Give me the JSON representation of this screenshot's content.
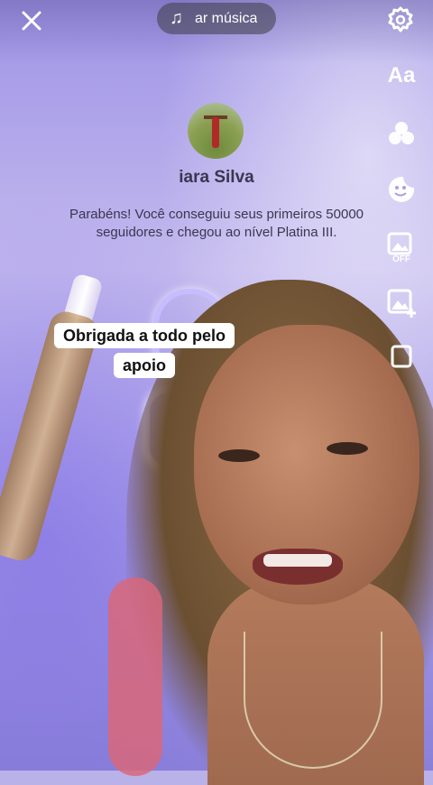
{
  "top_bar": {
    "close_icon": "close-icon",
    "music_label": "ar música",
    "music_icon": "music-note-icon",
    "settings_icon": "gear-icon"
  },
  "right_rail": {
    "text_label": "Aa",
    "filters_icon": "filters-icon",
    "sticker_icon": "sticker-icon",
    "photo_off_icon": "photo-off-icon",
    "photo_off_label": "OFF",
    "add_photo_icon": "add-photo-icon"
  },
  "card": {
    "user_name": "iara Silva",
    "message": "Parabéns! Você conseguiu seus primeiros 50000 seguidores e chegou ao nível Platina III."
  },
  "caption": {
    "text": "Obrigada a todo pelo apoio"
  },
  "colors": {
    "background_accent": "#a99fe8",
    "caption_background": "#ffffff",
    "text_dark": "#3b3650"
  }
}
